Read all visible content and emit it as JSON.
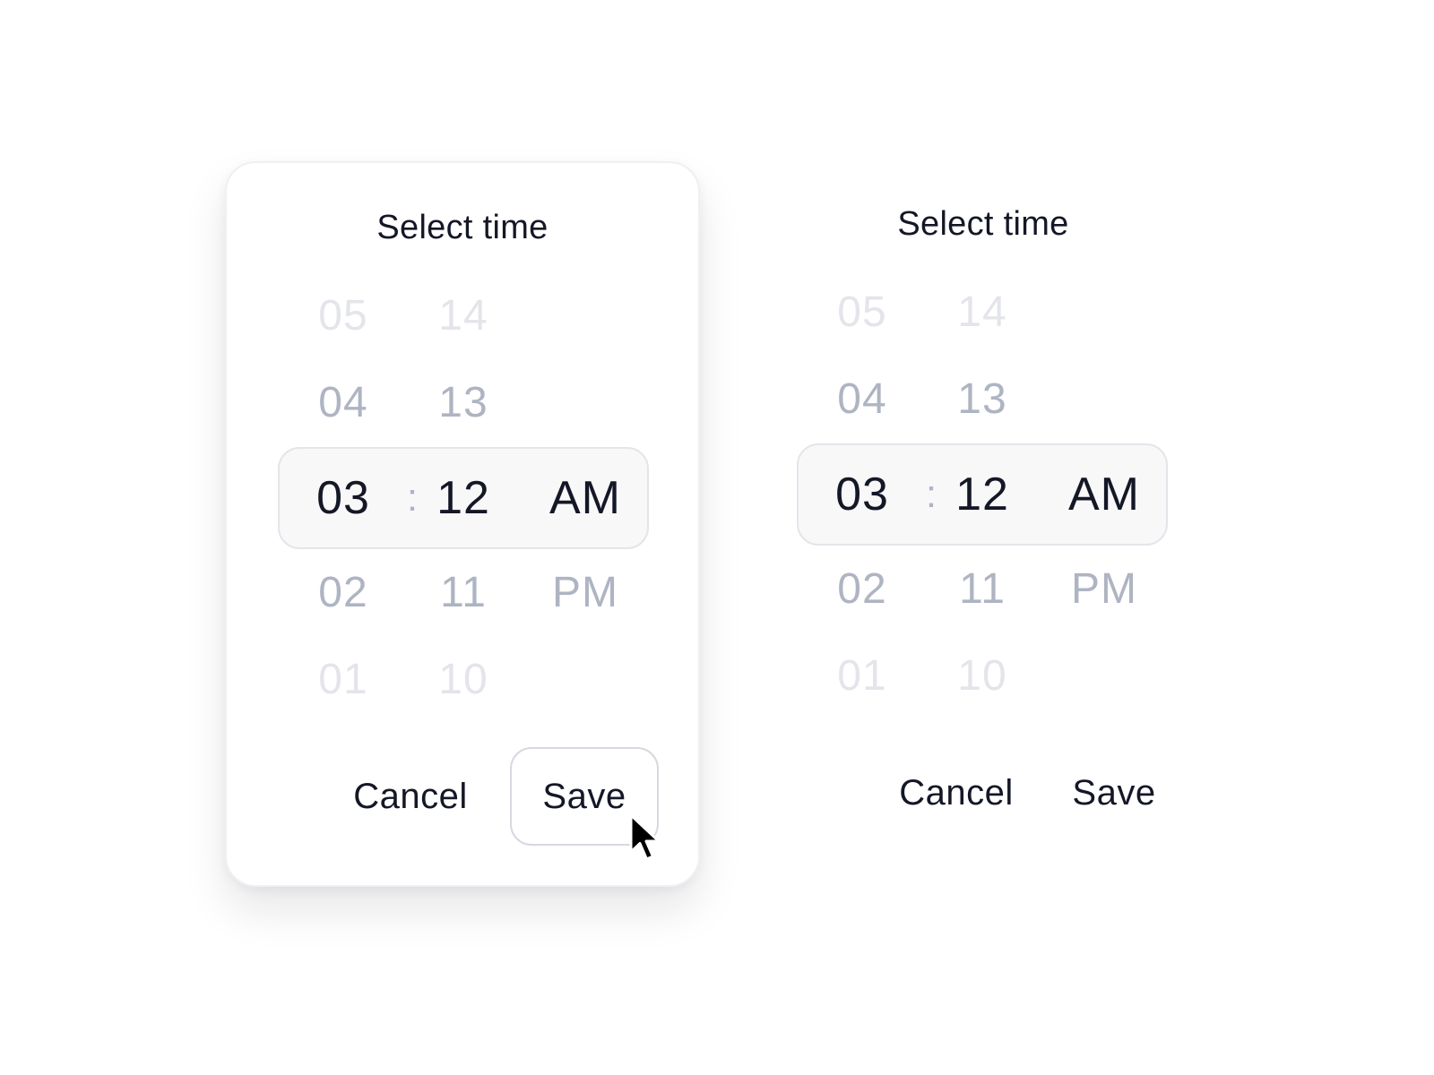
{
  "pickers": [
    {
      "variant": "card",
      "title": "Select time",
      "hours": {
        "far_above": "05",
        "above": "04",
        "selected": "03",
        "below": "02",
        "far_below": "01"
      },
      "separator": ":",
      "minutes": {
        "far_above": "14",
        "above": "13",
        "selected": "12",
        "below": "11",
        "far_below": "10"
      },
      "period": {
        "selected": "AM",
        "below": "PM"
      },
      "cancel_label": "Cancel",
      "save_label": "Save"
    },
    {
      "variant": "flat",
      "title": "Select time",
      "hours": {
        "far_above": "05",
        "above": "04",
        "selected": "03",
        "below": "02",
        "far_below": "01"
      },
      "separator": ":",
      "minutes": {
        "far_above": "14",
        "above": "13",
        "selected": "12",
        "below": "11",
        "far_below": "10"
      },
      "period": {
        "selected": "AM",
        "below": "PM"
      },
      "cancel_label": "Cancel",
      "save_label": "Save"
    }
  ],
  "cursor_icon": "pointer-arrow-icon",
  "colors": {
    "text": "#141726",
    "muted": "#aeb4c2",
    "faint": "#e3e5ea",
    "highlight_bg": "#f8f8f9",
    "border": "#d6d9e0"
  }
}
